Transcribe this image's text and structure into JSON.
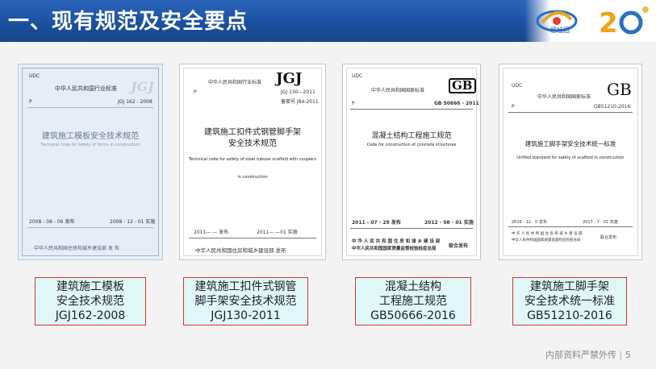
{
  "header": {
    "title": "一、现有规范及安全要点"
  },
  "logos": {
    "logo1_text": "碧桂园",
    "logo2_text": "20"
  },
  "covers": [
    {
      "top_label": "UDC",
      "issuer": "中华人民共和国行业标准",
      "code_mark": "JGJ",
      "left_mark": "P",
      "std_no": "JGJ 162 - 2008",
      "title_cn": "建筑施工模板安全技术规范",
      "title_en": "Technical code for safety of forms in construction",
      "issue_date": "2008 - 08 - 06  发布",
      "impl_date": "2008 - 12 - 01  实施",
      "publisher": "中华人民共和国住房和城乡建设部      发 布"
    },
    {
      "issuer": "中华人民共和国行业标准",
      "code_mark": "JGJ",
      "left_mark": "P",
      "std_no": "JGJ 130—2011",
      "record_no": "备案号 J84-2011",
      "title_cn_1": "建筑施工扣件式钢管脚手架",
      "title_cn_2": "安全技术规范",
      "title_en_1": "Technical code for safety of steel tubular scaffold with couplers",
      "title_en_2": "in construction",
      "issue_date": "2011—   —   发布",
      "impl_date": "2011—   —01 实施",
      "publisher": "中华人民共和国住房和城乡建设部   发布"
    },
    {
      "top_label": "UDC",
      "issuer": "中华人民共和国国家标准",
      "code_mark": "GB",
      "left_mark": "P",
      "std_no": "GB 50666 - 2011",
      "title_cn": "混凝土结构工程施工规范",
      "title_en": "Code for construction of concrete structures",
      "issue_date": "2011 - 07 - 29   发布",
      "impl_date": "2012 - 08 - 01   实施",
      "publisher_1": "中 华 人 民 共 和 国 住 房 和 城 乡 建 设 部",
      "publisher_2": "中华人民共和国国家质量监督检验检疫总局",
      "joint": "联合发布"
    },
    {
      "top_label": "UDC",
      "issuer": "中华人民共和国国家标准",
      "code_mark": "GB",
      "left_mark": "P",
      "std_no": "GB51210-2016",
      "title_cn": "建筑施工脚手架安全技术统一标准",
      "title_en": "Unified standard for safety of scaffold in construction",
      "issue_date": "2016 - 12 - 0   发布",
      "impl_date": "2017 - 7 - 01   实施",
      "publisher_1": "中 华 人 民 共 和 国 住 房 和 城 乡 建 设 部",
      "publisher_2": "中华人民共和国国家质量监督检验检疫总局",
      "joint": "联合发布"
    }
  ],
  "labels": [
    {
      "line1": "建筑施工模板",
      "line2": "安全技术规范",
      "line3": "JGJ162-2008"
    },
    {
      "line1": "建筑施工扣件式钢管",
      "line2": "脚手架安全技术规范",
      "line3": "JGJ130-2011"
    },
    {
      "line1": "混凝土结构",
      "line2": "工程施工规范",
      "line3": "GB50666-2016"
    },
    {
      "line1": "建筑施工脚手架",
      "line2": "安全技术统一标准",
      "line3": "GB51210-2016"
    }
  ],
  "footer": {
    "text": "内部资料严禁外传",
    "page": "5"
  }
}
